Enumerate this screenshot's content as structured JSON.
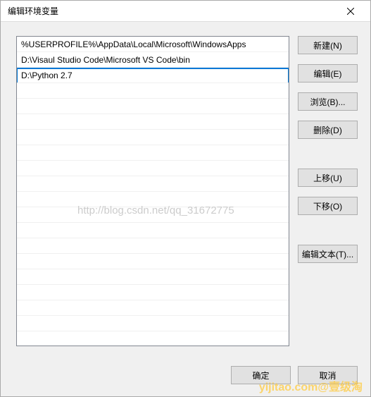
{
  "dialog": {
    "title": "编辑环境变量"
  },
  "list": {
    "items": [
      "%USERPROFILE%\\AppData\\Local\\Microsoft\\WindowsApps",
      "D:\\Visaul Studio Code\\Microsoft VS Code\\bin",
      "D:\\Python 2.7"
    ],
    "editing_index": 2
  },
  "buttons": {
    "new": "新建(N)",
    "edit": "编辑(E)",
    "browse": "浏览(B)...",
    "delete": "删除(D)",
    "move_up": "上移(U)",
    "move_down": "下移(O)",
    "edit_text": "编辑文本(T)...",
    "ok": "确定",
    "cancel": "取消"
  },
  "watermark": "http://blog.csdn.net/qq_31672775",
  "watermark2": "yijitao.com@壹级淘"
}
